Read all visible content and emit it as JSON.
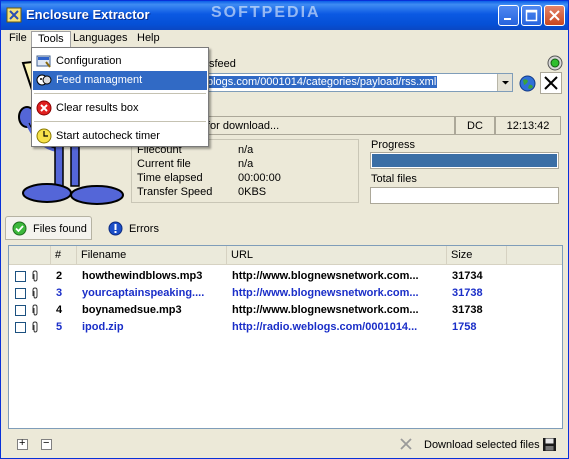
{
  "window": {
    "title": "Enclosure Extractor",
    "watermark": "SOFTPEDIA"
  },
  "menubar": {
    "items": [
      "File",
      "Tools",
      "Languages",
      "Help"
    ]
  },
  "tools_menu": {
    "items": [
      {
        "label": "Configuration",
        "icon": "config-icon",
        "highlighted": false
      },
      {
        "label": "Feed managment",
        "icon": "feed-icon",
        "highlighted": true
      },
      {
        "label": "Clear results box",
        "icon": "clear-icon",
        "highlighted": false
      },
      {
        "label": "Start autocheck timer",
        "icon": "timer-icon",
        "highlighted": false
      }
    ]
  },
  "feed": {
    "label_partial": "sfeed",
    "url_value": "blogs.com/0001014/categories/payload/rss.xml"
  },
  "status": {
    "message": "for download...",
    "mode": "DC",
    "time": "12:13:42"
  },
  "stats": {
    "labels": [
      "Filecount",
      "Current file",
      "Time elapsed",
      "Transfer Speed"
    ],
    "values": [
      "n/a",
      "n/a",
      "00:00:00",
      "0KBS"
    ]
  },
  "progress": {
    "label": "Progress",
    "value_fraction": 1.0,
    "total_files_label": "Total files",
    "total_files_fraction": 0.0
  },
  "tabs": {
    "files_found": "Files found",
    "errors": "Errors"
  },
  "table": {
    "columns": [
      "#",
      "Filename",
      "URL",
      "Size"
    ],
    "rows": [
      {
        "num": "2",
        "filename": "howthewindblows.mp3",
        "url": "http://www.blognewsnetwork.com...",
        "size": "31734",
        "color": "black"
      },
      {
        "num": "3",
        "filename": "yourcaptainspeaking....",
        "url": "http://www.blognewsnetwork.com...",
        "size": "31738",
        "color": "blue"
      },
      {
        "num": "4",
        "filename": "boynamedsue.mp3",
        "url": "http://www.blognewsnetwork.com...",
        "size": "31738",
        "color": "black"
      },
      {
        "num": "5",
        "filename": "ipod.zip",
        "url": "http://radio.weblogs.com/0001014...",
        "size": "1758",
        "color": "blue"
      }
    ]
  },
  "footer": {
    "expand": "+",
    "collapse": "−",
    "download_label": "Download selected files"
  },
  "colors": {
    "titlebar": "#0550d6",
    "highlight": "#316ac5",
    "link_blue": "#1a2ec8",
    "progress": "#3a6ea5"
  }
}
